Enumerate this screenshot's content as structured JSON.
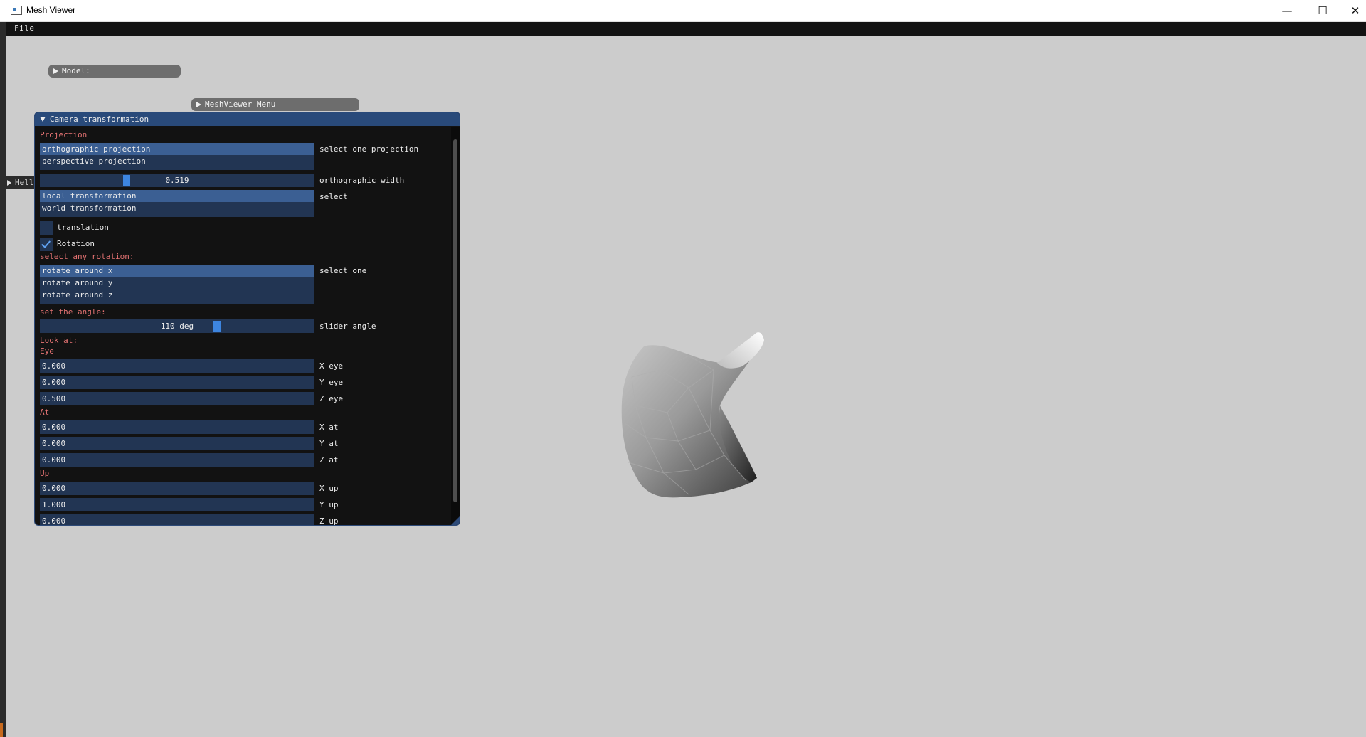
{
  "window": {
    "title": "Mesh Viewer",
    "minimize": "—",
    "maximize": "☐",
    "close": "✕"
  },
  "menubar": {
    "file": "File"
  },
  "collapsed_windows": {
    "model": "Model:",
    "meshviewer_menu": "MeshViewer Menu",
    "hello": "Hello"
  },
  "panel": {
    "title": "Camera transformation",
    "projection_label": "Projection",
    "projection_options": [
      "orthographic projection",
      "perspective projection"
    ],
    "projection_selected": 0,
    "projection_caption": "select one projection",
    "ortho_width_value": "0.519",
    "ortho_width_fraction": 0.31,
    "ortho_width_caption": "orthographic width",
    "transform_options": [
      "local transformation",
      "world transformation"
    ],
    "transform_caption": "select",
    "translation_label": "translation",
    "translation_checked": false,
    "rotation_label": "Rotation",
    "rotation_checked": true,
    "rotation_any_label": "select any rotation:",
    "rotation_options": [
      "rotate around x",
      "rotate around y",
      "rotate around z"
    ],
    "rotation_caption": "select one",
    "angle_label": "set the angle:",
    "angle_value": "110 deg",
    "angle_fraction": 0.65,
    "angle_caption": "slider angle",
    "lookat_label": "Look at:",
    "eye_label": "Eye",
    "eye": [
      {
        "value": "0.000",
        "caption": "X eye"
      },
      {
        "value": "0.000",
        "caption": "Y eye"
      },
      {
        "value": "0.500",
        "caption": "Z eye"
      }
    ],
    "at_label": "At",
    "at": [
      {
        "value": "0.000",
        "caption": "X at"
      },
      {
        "value": "0.000",
        "caption": "Y at"
      },
      {
        "value": "0.000",
        "caption": "Z at"
      }
    ],
    "up_label": "Up",
    "up": [
      {
        "value": "0.000",
        "caption": "X up"
      },
      {
        "value": "1.000",
        "caption": "Y up"
      },
      {
        "value": "0.000",
        "caption": "Z up"
      }
    ]
  },
  "colors": {
    "viewport_bg": "#cccccc",
    "panel_bg": "#121212",
    "header_bg": "#294a7a",
    "field_bg": "#223553",
    "selected_bg": "#3b5f93",
    "section_text": "#e57373",
    "slider_grab": "#3d85e0"
  }
}
